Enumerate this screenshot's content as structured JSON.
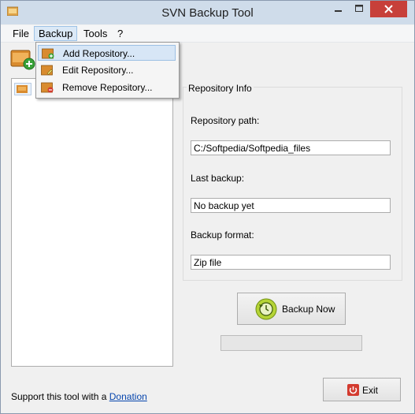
{
  "window": {
    "title": "SVN Backup Tool"
  },
  "menu": {
    "file": "File",
    "backup": "Backup",
    "tools": "Tools",
    "help": "?"
  },
  "dropdown": {
    "items": [
      "Add Repository...",
      "Edit Repository...",
      "Remove Repository..."
    ]
  },
  "info": {
    "group_title": "Repository Info",
    "path_label": "Repository path:",
    "path_value": "C:/Softpedia/Softpedia_files",
    "last_label": "Last backup:",
    "last_value": "No backup yet",
    "format_label": "Backup format:",
    "format_value": "Zip file"
  },
  "actions": {
    "backup_now": "Backup Now",
    "exit": "Exit",
    "progress": 0
  },
  "footer": {
    "support_text": "Support this tool with a",
    "donation_link": "Donation"
  },
  "colors": {
    "titlebar": "#cfdcea",
    "close": "#c7403a",
    "accent": "#0645ad",
    "folder": "#d98b2e"
  }
}
